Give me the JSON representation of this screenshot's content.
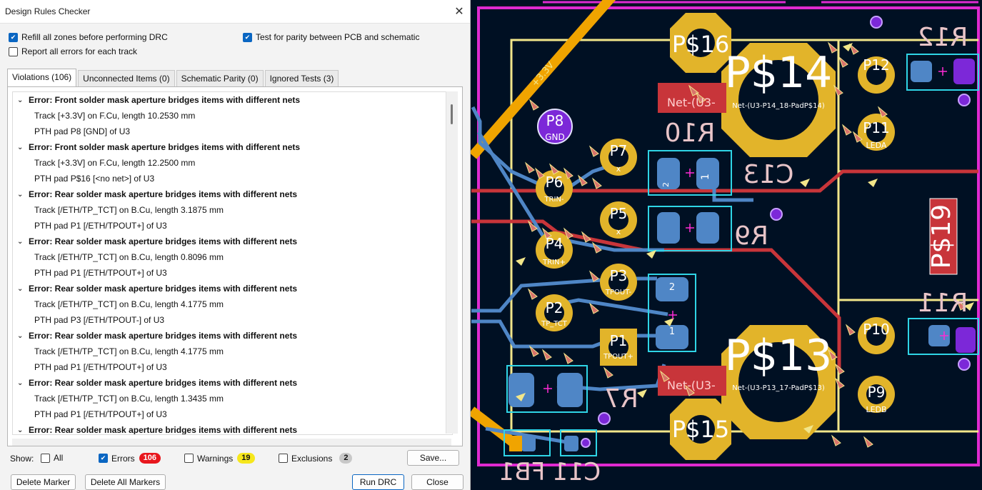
{
  "dialog": {
    "title": "Design Rules Checker",
    "options": {
      "refill_zones": {
        "label": "Refill all zones before performing DRC",
        "checked": true
      },
      "report_all": {
        "label": "Report all errors for each track",
        "checked": false
      },
      "test_parity": {
        "label": "Test for parity between PCB and schematic",
        "checked": true
      }
    },
    "tabs": [
      {
        "label": "Violations (106)",
        "active": true
      },
      {
        "label": "Unconnected Items (0)",
        "active": false
      },
      {
        "label": "Schematic Parity (0)",
        "active": false
      },
      {
        "label": "Ignored Tests (3)",
        "active": false
      }
    ],
    "violations": [
      {
        "error": "Error: Front solder mask aperture bridges items with different nets",
        "items": [
          "Track [+3.3V] on F.Cu, length 10.2530 mm",
          "PTH pad P8 [GND] of U3"
        ]
      },
      {
        "error": "Error: Front solder mask aperture bridges items with different nets",
        "items": [
          "Track [+3.3V] on F.Cu, length 12.2500 mm",
          "PTH pad P$16 [<no net>] of U3"
        ]
      },
      {
        "error": "Error: Rear solder mask aperture bridges items with different nets",
        "items": [
          "Track [/ETH/TP_TCT] on B.Cu, length 3.1875 mm",
          "PTH pad P1 [/ETH/TPOUT+] of U3"
        ]
      },
      {
        "error": "Error: Rear solder mask aperture bridges items with different nets",
        "items": [
          "Track [/ETH/TP_TCT] on B.Cu, length 0.8096 mm",
          "PTH pad P1 [/ETH/TPOUT+] of U3"
        ]
      },
      {
        "error": "Error: Rear solder mask aperture bridges items with different nets",
        "items": [
          "Track [/ETH/TP_TCT] on B.Cu, length 4.1775 mm",
          "PTH pad P3 [/ETH/TPOUT-] of U3"
        ]
      },
      {
        "error": "Error: Rear solder mask aperture bridges items with different nets",
        "items": [
          "Track [/ETH/TP_TCT] on B.Cu, length 4.1775 mm",
          "PTH pad P1 [/ETH/TPOUT+] of U3"
        ]
      },
      {
        "error": "Error: Rear solder mask aperture bridges items with different nets",
        "items": [
          "Track [/ETH/TP_TCT] on B.Cu, length 1.3435 mm",
          "PTH pad P1 [/ETH/TPOUT+] of U3"
        ]
      },
      {
        "error": "Error: Rear solder mask aperture bridges items with different nets",
        "items": []
      }
    ],
    "show": {
      "label": "Show:",
      "all": {
        "label": "All",
        "checked": false
      },
      "errors": {
        "label": "Errors",
        "checked": true,
        "count": "106",
        "color": "#e8171d"
      },
      "warnings": {
        "label": "Warnings",
        "checked": false,
        "count": "19",
        "color": "#f6e71c"
      },
      "exclusions": {
        "label": "Exclusions",
        "checked": false,
        "count": "2",
        "color": "#c8c8c8"
      }
    },
    "buttons": {
      "save": "Save...",
      "delete_marker": "Delete Marker",
      "delete_all_markers": "Delete All Markers",
      "run_drc": "Run DRC",
      "close": "Close"
    }
  },
  "pcb": {
    "colors": {
      "background": "#001023",
      "edge": "#e02ad0",
      "silk": "#f2e68a",
      "pad": "#e2b42a",
      "front_copper": "#c8353a",
      "back_copper": "#4f86c6",
      "marker": "#d9736b"
    },
    "labels": {
      "p16": "P$16",
      "p14": "P$14",
      "p13": "P$13",
      "p15": "P$15",
      "p19": "P$19",
      "p8": "P8",
      "gnd": "GND",
      "p7": "P7",
      "p6": "P6",
      "trin": "TRIN-",
      "p5": "P5",
      "p4": "P4",
      "trinp": "TRIN+",
      "p3": "P3",
      "tpout": "TPOUT-",
      "p2": "P2",
      "tptct": "TP_TCT",
      "p1": "P1",
      "tpoutp": "TPOUT+",
      "p12": "P12",
      "p11": "P11",
      "leda": "LEDA",
      "p10": "P10",
      "p9": "P9",
      "ledb": "LEDB",
      "r12": "R12",
      "r10": "R10",
      "r9": "R9",
      "r11": "R11",
      "r7": "R7",
      "c13": "C13",
      "c11fb1": "C11 FB1",
      "net_u3": "Net-(U3-",
      "net_p14": "Net-(U3-P14_18-PadP$14)",
      "net_p13": "Net-(U3-P13_17-PadP$13)",
      "v33": "+3.3V",
      "x": "x",
      "pin1": "1",
      "pin2": "2"
    }
  }
}
